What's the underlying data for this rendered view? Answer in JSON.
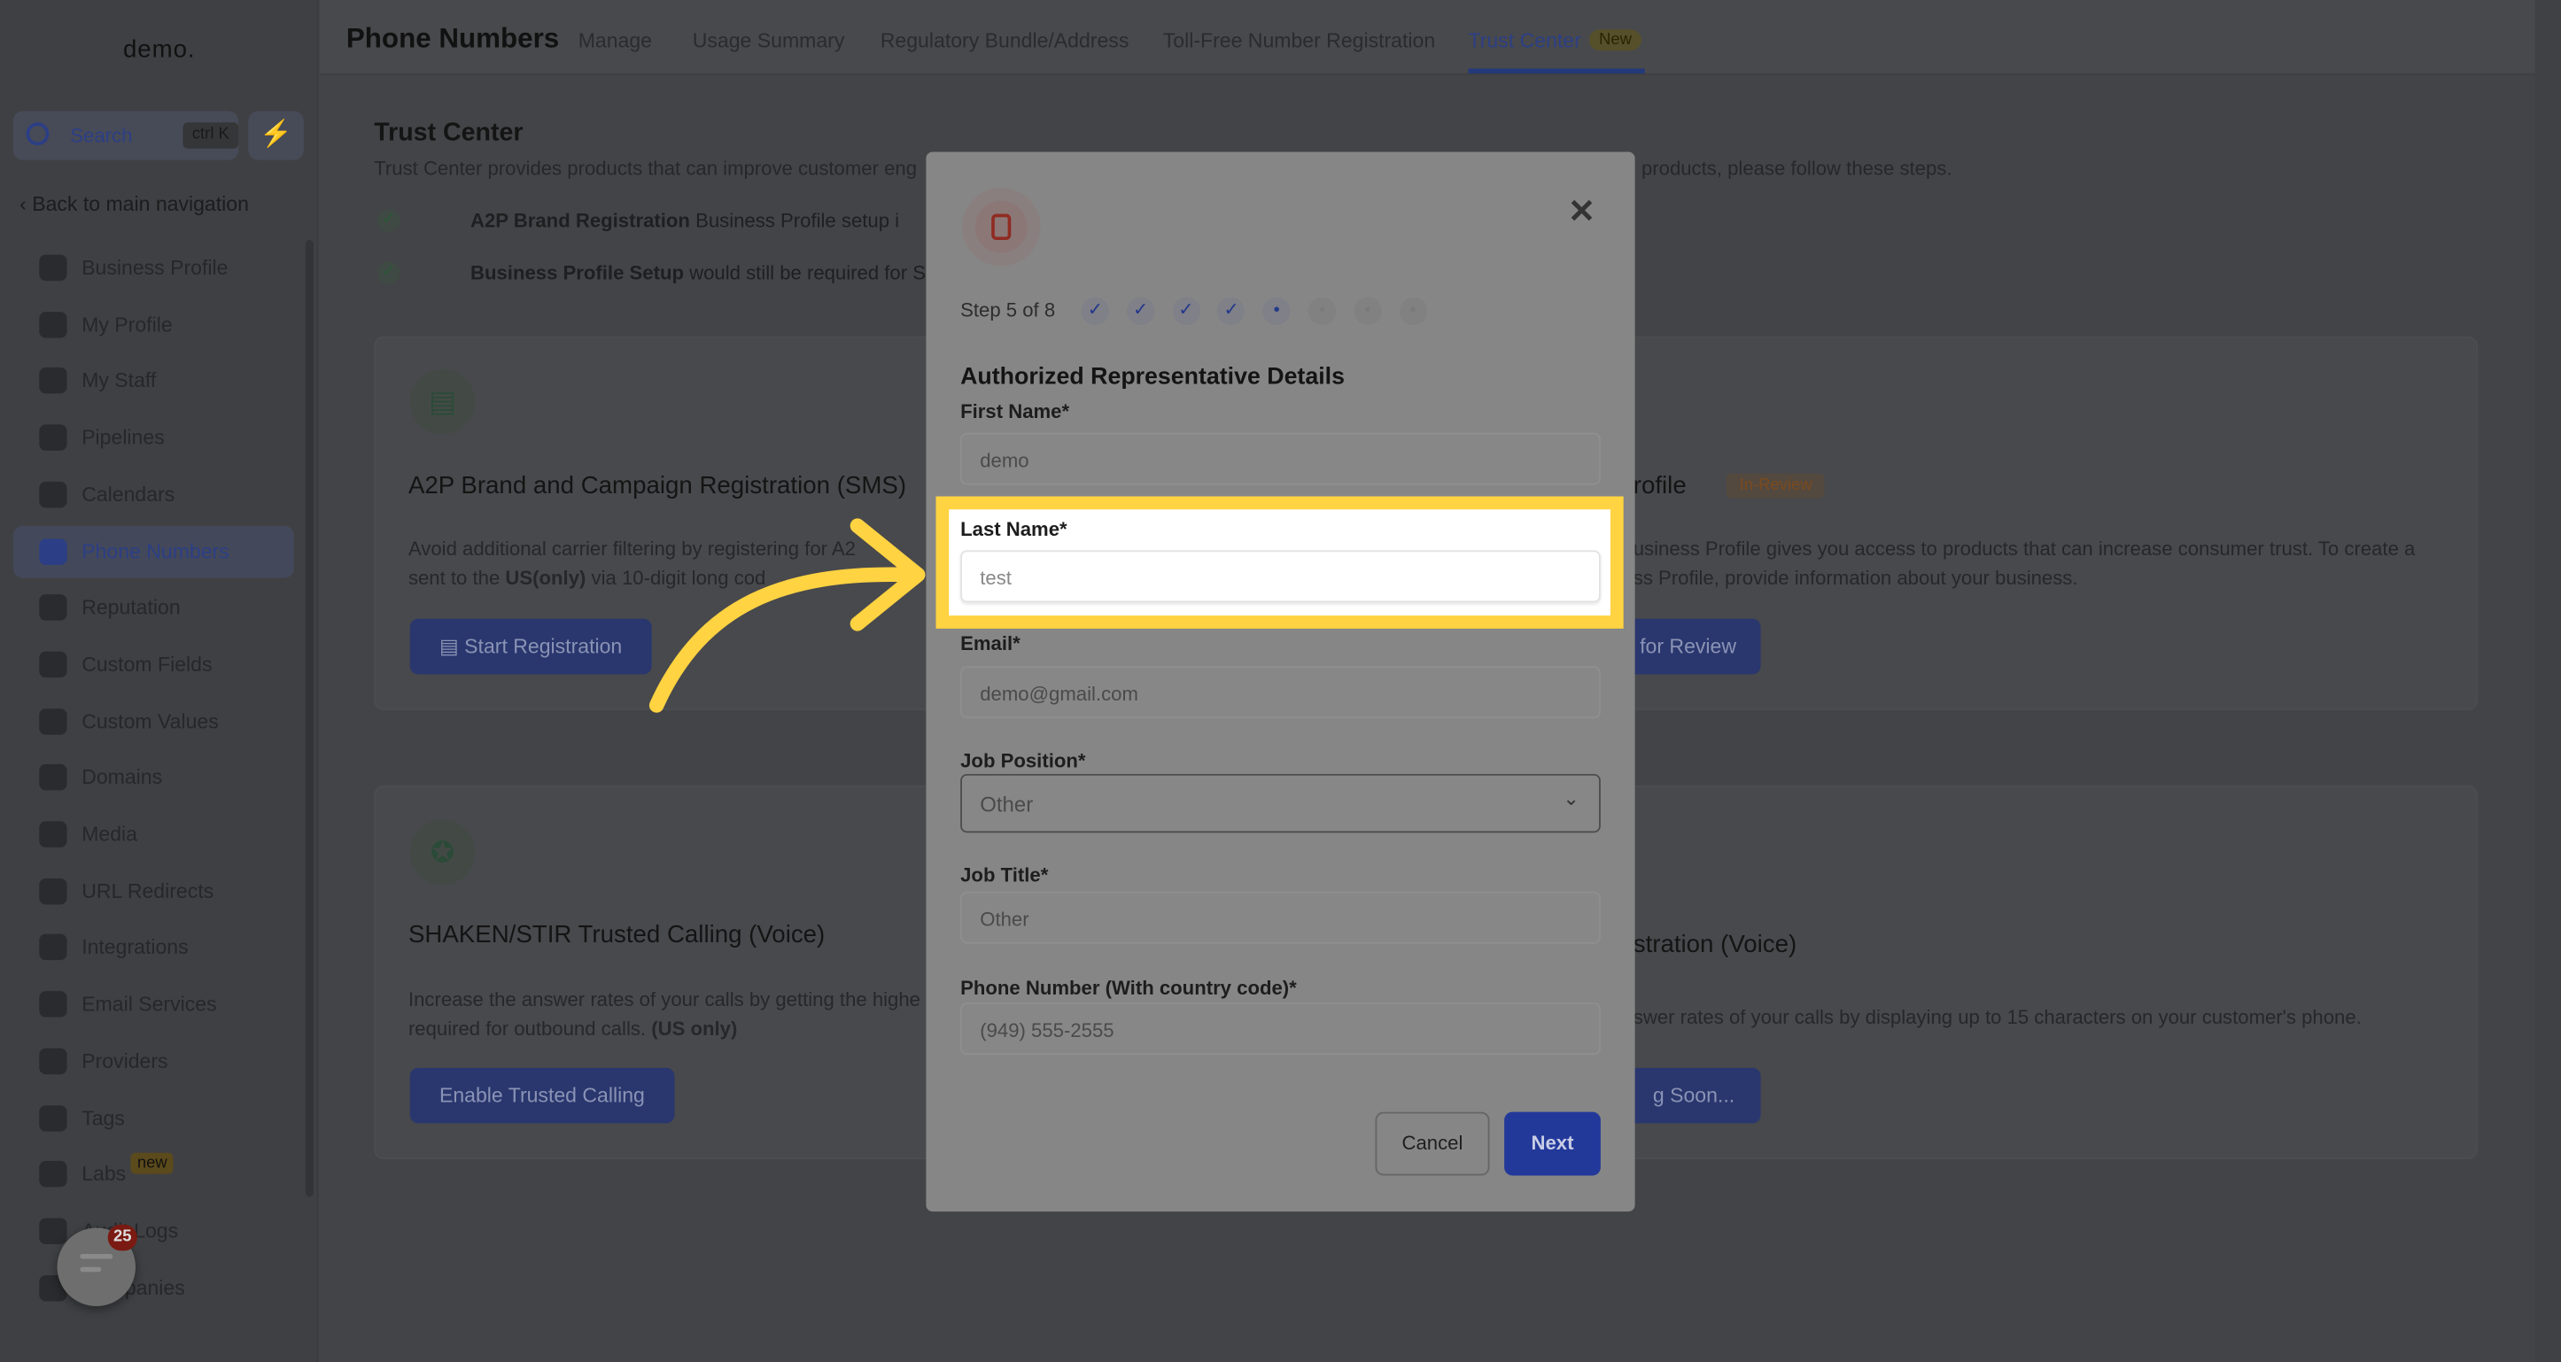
{
  "brand": "demo.",
  "sidebar": {
    "search_label": "Search",
    "search_shortcut": "ctrl K",
    "back_label": "Back to main navigation",
    "items": [
      {
        "label": "Business Profile"
      },
      {
        "label": "My Profile"
      },
      {
        "label": "My Staff"
      },
      {
        "label": "Pipelines"
      },
      {
        "label": "Calendars"
      },
      {
        "label": "Phone Numbers",
        "active": true
      },
      {
        "label": "Reputation"
      },
      {
        "label": "Custom Fields"
      },
      {
        "label": "Custom Values"
      },
      {
        "label": "Domains"
      },
      {
        "label": "Media"
      },
      {
        "label": "URL Redirects"
      },
      {
        "label": "Integrations"
      },
      {
        "label": "Email Services"
      },
      {
        "label": "Providers"
      },
      {
        "label": "Tags"
      },
      {
        "label": "Labs"
      },
      {
        "label": "Audit Logs"
      },
      {
        "label": "Companies"
      }
    ],
    "labs_badge": "new"
  },
  "header": {
    "title": "Phone Numbers",
    "tabs": [
      "Manage",
      "Usage Summary",
      "Regulatory Bundle/Address",
      "Toll-Free Number Registration",
      "Trust Center"
    ],
    "active_tab": "Trust Center",
    "new_badge": "New"
  },
  "trust_center": {
    "title": "Trust Center",
    "desc_left": "Trust Center provides products that can improve customer eng",
    "desc_right": "products, please follow these steps.",
    "steps": [
      {
        "bold": "A2P Brand Registration",
        "text": " Business Profile setup i"
      },
      {
        "bold": "Business Profile Setup",
        "text": " would still be required for SH"
      }
    ],
    "cards": [
      {
        "title": "A2P Brand and Campaign Registration (SMS)",
        "p1": "Avoid additional carrier filtering by registering for A2",
        "p2a": "sent to the ",
        "p2b": "US(only)",
        "p2c": " via 10-digit long cod",
        "button": "Start Registration"
      },
      {
        "title": "rofile",
        "badge": "In-Review",
        "p1": "usiness Profile gives you access to products that can increase consumer trust. To create a",
        "p2": "ss Profile, provide information about your business.",
        "button": "for Review"
      },
      {
        "title": "SHAKEN/STIR Trusted Calling (Voice)",
        "p1": "Increase the answer rates of your calls by getting the highe",
        "p2a": "required for outbound calls. ",
        "p2b": "(US only)",
        "button": "Enable Trusted Calling"
      },
      {
        "title": "stration (Voice)",
        "p1": "swer rates of your calls by displaying up to 15 characters on your customer's phone.",
        "button": "g Soon..."
      }
    ]
  },
  "modal": {
    "step_label": "Step 5 of 8",
    "total_steps": 8,
    "current_step": 5,
    "section_title": "Authorized Representative Details",
    "fields": {
      "first_name": {
        "label": "First Name*",
        "value": "demo"
      },
      "last_name": {
        "label": "Last Name*",
        "value": "test"
      },
      "email": {
        "label": "Email*",
        "value": "demo@gmail.com"
      },
      "job_position": {
        "label": "Job Position*",
        "value": "Other"
      },
      "job_title": {
        "label": "Job Title*",
        "value": "Other"
      },
      "phone": {
        "label": "Phone Number (With country code)*",
        "value": "(949) 555-2555"
      }
    },
    "cancel": "Cancel",
    "next": "Next"
  },
  "chat": {
    "count": "25"
  },
  "colors": {
    "highlight": "#ffd341",
    "arrow": "#ffd341",
    "accent": "#23399a"
  }
}
